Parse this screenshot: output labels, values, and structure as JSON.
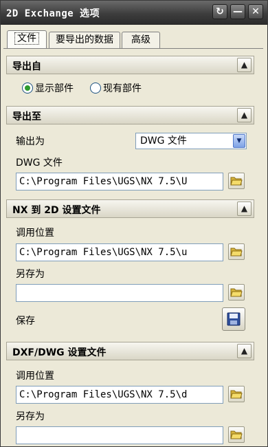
{
  "window": {
    "title": "2D Exchange 选项"
  },
  "tabs": [
    {
      "label": "文件",
      "active": true
    },
    {
      "label": "要导出的数据",
      "active": false
    },
    {
      "label": "高级",
      "active": false
    }
  ],
  "export_from": {
    "title": "导出自",
    "options": [
      {
        "label": "显示部件",
        "selected": true
      },
      {
        "label": "现有部件",
        "selected": false
      }
    ]
  },
  "export_to": {
    "title": "导出至",
    "output_label": "输出为",
    "output_value": "DWG 文件",
    "file_label": "DWG 文件",
    "file_path": "C:\\Program Files\\UGS\\NX 7.5\\U"
  },
  "nx_to_2d": {
    "title": "NX 到 2D 设置文件",
    "load_label": "调用位置",
    "load_path": "C:\\Program Files\\UGS\\NX 7.5\\u",
    "save_as_label": "另存为",
    "save_as_path": "",
    "save_label": "保存"
  },
  "dxf_dwg": {
    "title": "DXF/DWG 设置文件",
    "load_label": "调用位置",
    "load_path": "C:\\Program Files\\UGS\\NX 7.5\\d",
    "save_as_label": "另存为",
    "save_as_path": ""
  },
  "icons": {
    "refresh": "refresh-icon",
    "minimize": "minimize-icon",
    "close": "close-icon",
    "collapse": "chevron-up-icon",
    "folder": "open-folder-icon",
    "save": "floppy-disk-icon",
    "dropdown": "triangle-down-icon"
  },
  "colors": {
    "titlebar": "#3e3e3e",
    "window_bg": "#ece9d8",
    "radio_dot": "#2e9b2e"
  }
}
